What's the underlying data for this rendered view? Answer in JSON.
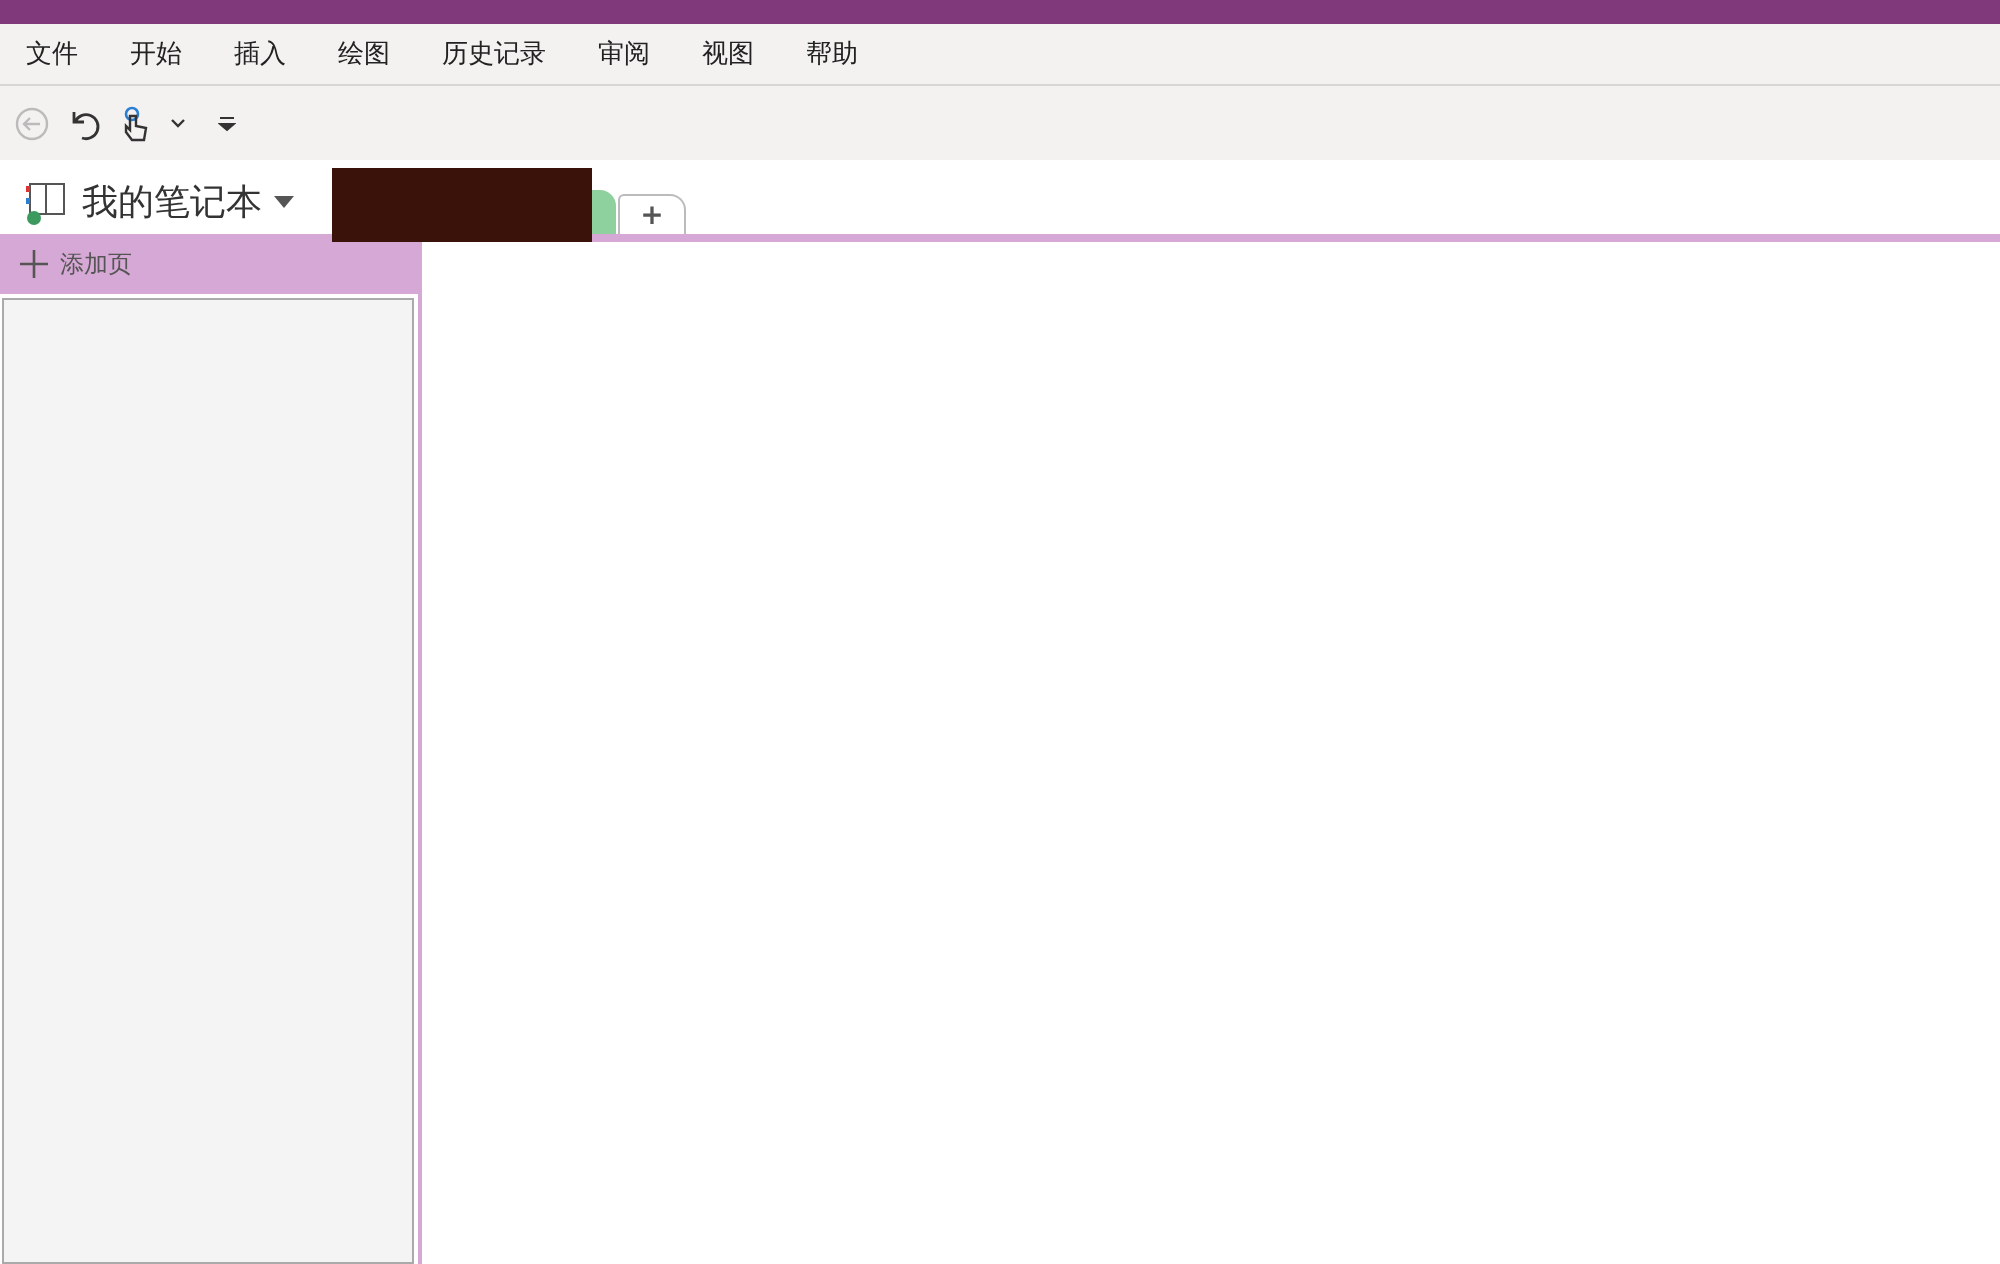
{
  "menu": [
    {
      "label": "文件"
    },
    {
      "label": "开始"
    },
    {
      "label": "插入"
    },
    {
      "label": "绘图"
    },
    {
      "label": "历史记录"
    },
    {
      "label": "审阅"
    },
    {
      "label": "视图"
    },
    {
      "label": "帮助"
    }
  ],
  "notebook": {
    "name": "我的笔记本"
  },
  "sections": [
    {
      "color": "#8fd19e"
    }
  ],
  "add_section": {
    "label": "+"
  },
  "add_page": {
    "label": "添加页"
  }
}
